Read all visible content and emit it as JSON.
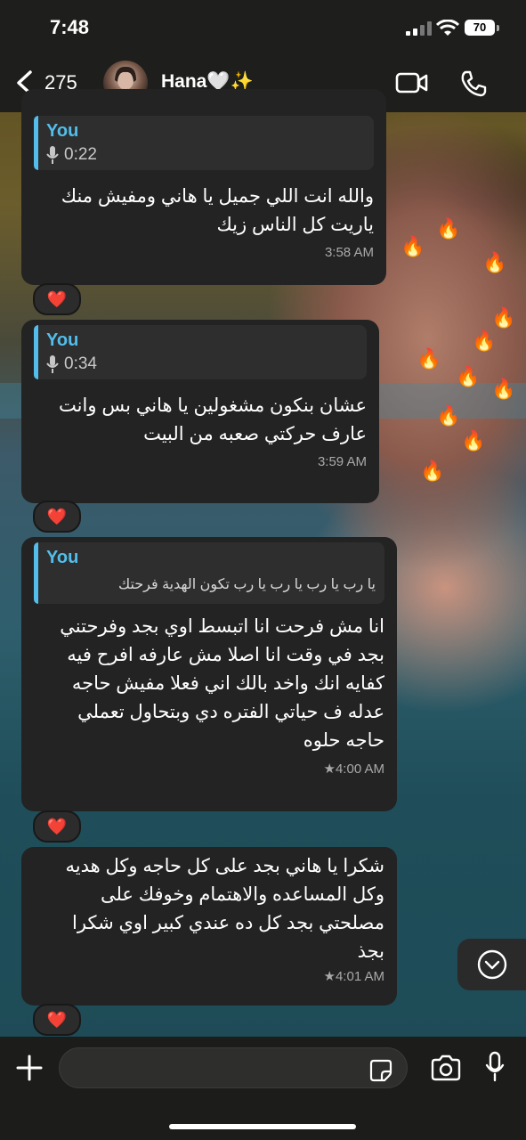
{
  "status_bar": {
    "time": "7:48",
    "battery": "70"
  },
  "header": {
    "back_count": "275",
    "contact_name": "Hana🤍✨"
  },
  "messages": [
    {
      "quote_author": "You",
      "quote_duration": "0:22",
      "lines": [
        "والله انت اللي جميل يا هاني ومفيش منك",
        "ياريت كل الناس زيك"
      ],
      "time": "3:58 AM",
      "reaction": "❤️"
    },
    {
      "quote_author": "You",
      "quote_duration": "0:34",
      "lines": [
        "عشان بنكون مشغولين يا هاني بس وانت",
        "عارف حركتي صعبه من البيت"
      ],
      "time": "3:59 AM",
      "reaction": "❤️"
    },
    {
      "quote_author": "You",
      "quote_text": "يا رب يا رب يا رب يا رب تكون الهدية فرحتك",
      "lines": [
        "انا مش فرحت انا اتبسط اوي بجد وفرحتني",
        "بجد في وقت انا اصلا مش عارفه افرح فيه",
        "كفايه انك واخد بالك اني فعلا مفيش حاجه",
        "عدله ف حياتي الفتره دي وبتحاول تعملي",
        "حاجه حلوه"
      ],
      "time": "★4:00 AM",
      "reaction": "❤️"
    },
    {
      "lines": [
        "شكرا يا هاني بجد على كل حاجه وكل هديه",
        "وكل المساعده والاهتمام وخوفك على",
        "مصلحتي بجد كل ده عندي كبير اوي شكرا",
        "بجذ"
      ],
      "time": "★4:01 AM",
      "reaction": "❤️"
    }
  ],
  "composer": {
    "value": ""
  },
  "icons": {
    "back": "chevron-left-icon",
    "video": "video-camera-icon",
    "call": "phone-icon",
    "plus": "plus-icon",
    "sticker": "sticker-icon",
    "camera": "camera-icon",
    "mic": "microphone-icon",
    "scroll": "scroll-down-icon"
  },
  "colors": {
    "quote_accent": "#53bdeb",
    "bubble": "#222322",
    "reaction_heart": "#ff2d48"
  }
}
